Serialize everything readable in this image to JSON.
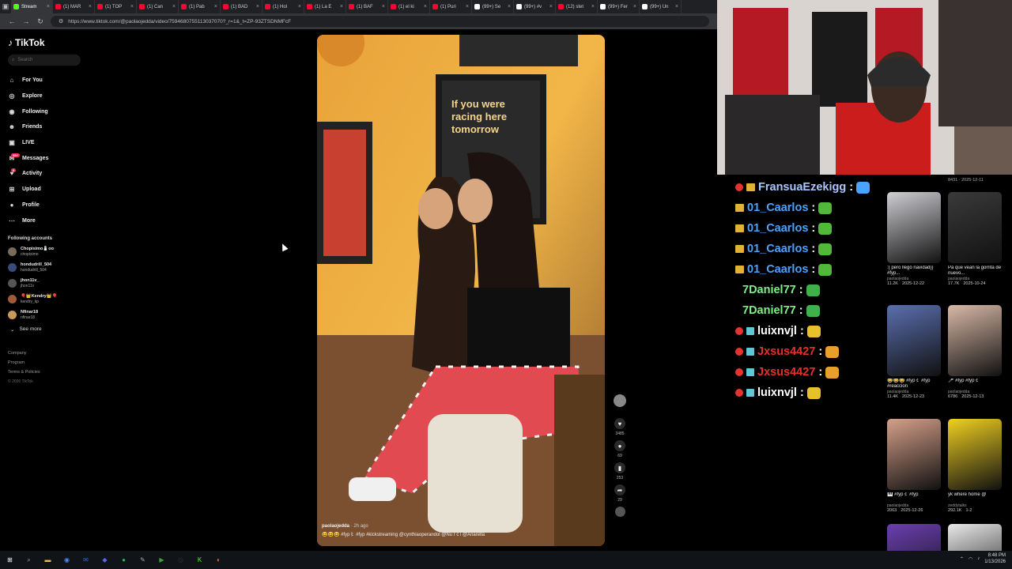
{
  "browser": {
    "tabs": [
      {
        "label": "Stream",
        "color": "#53fc18"
      },
      {
        "label": "(1) MAR",
        "color": "#ff0033"
      },
      {
        "label": "(1) TOP",
        "color": "#ff0033"
      },
      {
        "label": "(1) Can",
        "color": "#ff0033"
      },
      {
        "label": "(1) Pab",
        "color": "#ff0033"
      },
      {
        "label": "(1) BAD",
        "color": "#ff0033"
      },
      {
        "label": "(1) Hol",
        "color": "#ff0033"
      },
      {
        "label": "(1) La E",
        "color": "#ff0033"
      },
      {
        "label": "(1) BAF",
        "color": "#ff0033"
      },
      {
        "label": "(1) el ki",
        "color": "#ff0033"
      },
      {
        "label": "(1) Puri",
        "color": "#ff0033"
      },
      {
        "label": "(99+) Se",
        "color": "#ffffff"
      },
      {
        "label": "(99+) #v",
        "color": "#ffffff"
      },
      {
        "label": "(12) stet",
        "color": "#ff0033"
      },
      {
        "label": "(99+) Fer",
        "color": "#ffffff"
      },
      {
        "label": "(99+) Un",
        "color": "#ffffff"
      }
    ],
    "url": "https://www.tiktok.com/@paolaojedda/video/7594680755113037070?_r=1&_t=ZP-93ZTSDNMFcF"
  },
  "tiktok": {
    "logo": "TikTok",
    "search_placeholder": "Search",
    "nav": [
      {
        "label": "For You",
        "icon": "home-icon"
      },
      {
        "label": "Explore",
        "icon": "compass-icon"
      },
      {
        "label": "Following",
        "icon": "following-icon"
      },
      {
        "label": "Friends",
        "icon": "friends-icon"
      },
      {
        "label": "LIVE",
        "icon": "live-icon"
      },
      {
        "label": "Messages",
        "icon": "messages-icon",
        "badge": "99+"
      },
      {
        "label": "Activity",
        "icon": "activity-icon",
        "badge": "8"
      },
      {
        "label": "Upload",
        "icon": "upload-icon"
      },
      {
        "label": "Profile",
        "icon": "profile-icon"
      },
      {
        "label": "More",
        "icon": "more-icon"
      }
    ],
    "following_title": "Following accounts",
    "accounts": [
      {
        "name": "Chopisimo🧂oo",
        "handle": "chopisimo"
      },
      {
        "name": "hondudrill_504",
        "handle": "hondudrill_504"
      },
      {
        "name": "jhon11v_",
        "handle": "jhon11v"
      },
      {
        "name": "🎈👑Kendry👑🎈",
        "handle": "kendry_kp"
      },
      {
        "name": "Nfinar18",
        "handle": "nfinar18"
      }
    ],
    "see_more": "See more",
    "footer": [
      "Company",
      "Program",
      "Terms & Policies"
    ],
    "copyright": "© 2026 TikTok",
    "video": {
      "author": "paolaojedda",
      "date": "2h ago",
      "caption": "😆😆😆 #fyp〻 #fyp #kickstreaming @cynthiaoperandol @Nu r c i @Anarella",
      "poster_text": "If you were racing here tomorrow"
    },
    "actions": [
      {
        "name": "like",
        "icon": "heart-icon",
        "count": "3485"
      },
      {
        "name": "comment",
        "icon": "comment-icon",
        "count": "69"
      },
      {
        "name": "save",
        "icon": "bookmark-icon",
        "count": "253"
      },
      {
        "name": "share",
        "icon": "share-icon",
        "count": "29"
      }
    ]
  },
  "chat": [
    {
      "badges": [
        "sub",
        "mod"
      ],
      "user": "FransuaEzekigg",
      "color": "#a9c6ff",
      "emote": "#4aa3ff"
    },
    {
      "badges": [
        "mod"
      ],
      "user": "01_Caarlos",
      "color": "#4aa3ff",
      "emote": "#52b83a"
    },
    {
      "badges": [
        "mod"
      ],
      "user": "01_Caarlos",
      "color": "#4aa3ff",
      "emote": "#52b83a"
    },
    {
      "badges": [
        "mod"
      ],
      "user": "01_Caarlos",
      "color": "#4aa3ff",
      "emote": "#52b83a"
    },
    {
      "badges": [
        "mod"
      ],
      "user": "01_Caarlos",
      "color": "#4aa3ff",
      "emote": "#52b83a"
    },
    {
      "badges": [],
      "user": "7Daniel77",
      "color": "#7ef08a",
      "emote": "#3fb04a"
    },
    {
      "badges": [],
      "user": "7Daniel77",
      "color": "#7ef08a",
      "emote": "#3fb04a"
    },
    {
      "badges": [
        "sub",
        "vip"
      ],
      "user": "luixnvjl",
      "color": "#ffffff",
      "emote": "#e8c02a"
    },
    {
      "badges": [
        "sub",
        "vip"
      ],
      "user": "Jxsus4427",
      "color": "#e8302a",
      "emote": "#e8a02a"
    },
    {
      "badges": [
        "sub",
        "vip"
      ],
      "user": "Jxsus4427",
      "color": "#e8302a",
      "emote": "#e8a02a"
    },
    {
      "badges": [
        "sub",
        "vip"
      ],
      "user": "luixnvjl",
      "color": "#ffffff",
      "emote": "#e8c02a"
    }
  ],
  "chat_separator": ":",
  "grid": {
    "top_stat": "8431 · 2025-12-11",
    "items": [
      {
        "caption": ":( pero llegó navidad}} #fyp...",
        "author": "paolaojedda",
        "views": "11.2K",
        "date": "2025-12-22",
        "color": "#cfcfd4"
      },
      {
        "caption": "Pa que vean la gorrita de nuevo...",
        "author": "paolaojedda",
        "views": "17.7K",
        "date": "2025-10-24",
        "color": "#3a3a3a"
      },
      {
        "caption": "😂😂😂 #fyp〻 #fyp #reaccion",
        "author": "paolaojedda",
        "views": "11.4K",
        "date": "2025-12-23",
        "color": "#5a6fb0"
      },
      {
        "caption": "🎤 #fyp #fyp〻",
        "author": "paolaojedda",
        "views": "6786",
        "date": "2025-12-13",
        "color": "#d9b9a7"
      },
      {
        "caption": "🎹 #fyp〻 #fyp",
        "author": "paolaojedda",
        "views": "2063",
        "date": "2025-12-26",
        "color": "#d6a089"
      },
      {
        "caption": "yk where home @",
        "author": "zeddytalks",
        "views": "292.1K",
        "date": "1-2",
        "color": "#f0d020"
      },
      {
        "caption": "",
        "author": "",
        "views": "",
        "date": "",
        "color": "#6a3fb0"
      },
      {
        "caption": "",
        "author": "",
        "views": "",
        "date": "",
        "color": "#e9e9e9"
      }
    ]
  },
  "taskbar": {
    "time": "8:48 PM",
    "date": "1/13/2026",
    "apps": [
      "start-icon",
      "search-icon",
      "file-explorer-icon",
      "chrome-icon",
      "outlook-icon",
      "discord-icon",
      "spotify-icon",
      "pen-icon",
      "terminal-icon",
      "obs-icon",
      "kick-icon",
      "app-icon"
    ]
  }
}
